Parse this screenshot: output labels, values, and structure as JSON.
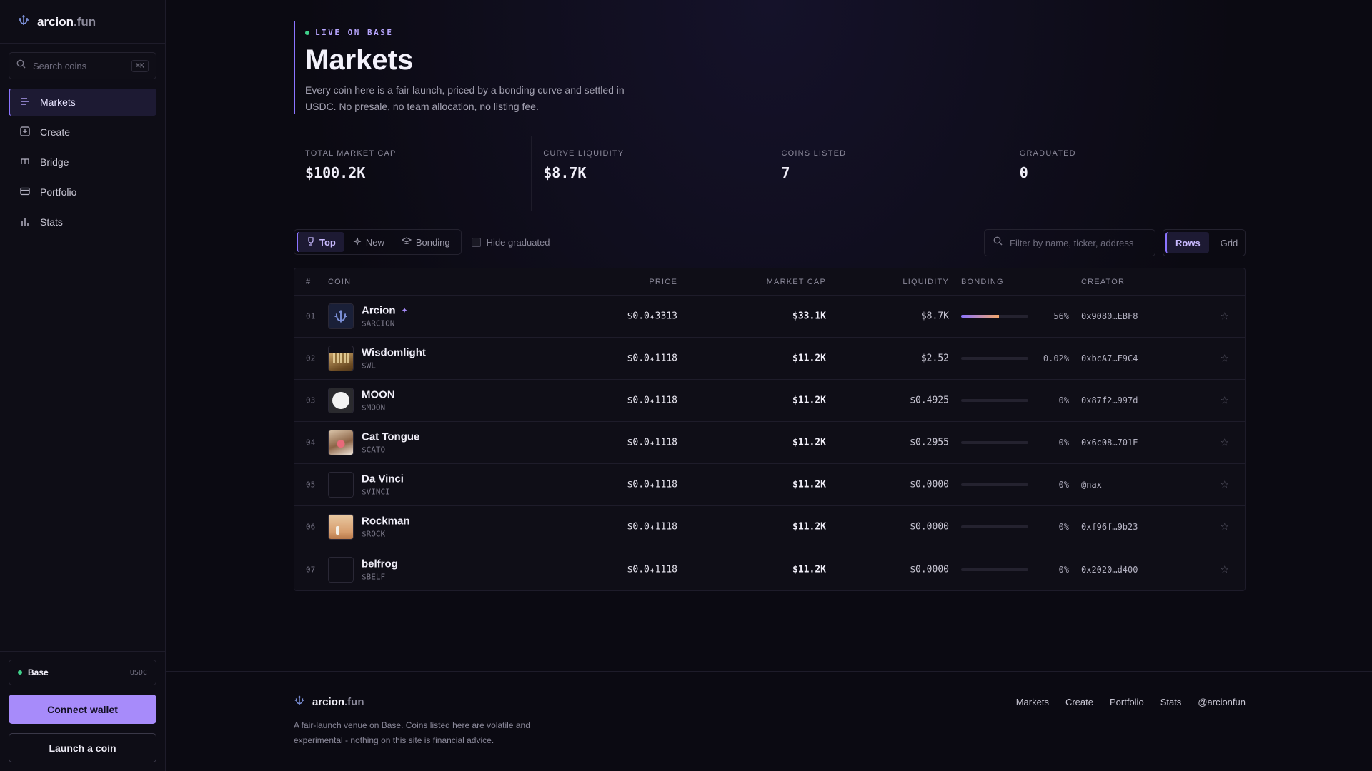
{
  "brand": {
    "name_main": "arcion",
    "name_suffix": ".fun"
  },
  "sidebar": {
    "search_placeholder": "Search coins",
    "search_shortcut": "⌘K",
    "nav": [
      {
        "label": "Markets",
        "icon": "list-icon",
        "active": true
      },
      {
        "label": "Create",
        "icon": "plus-square-icon",
        "active": false
      },
      {
        "label": "Bridge",
        "icon": "bridge-icon",
        "active": false
      },
      {
        "label": "Portfolio",
        "icon": "wallet-icon",
        "active": false
      },
      {
        "label": "Stats",
        "icon": "bar-chart-icon",
        "active": false
      }
    ],
    "network": {
      "name": "Base",
      "currency": "USDC",
      "status_color": "#3fd08a"
    },
    "connect_label": "Connect wallet",
    "launch_label": "Launch a coin"
  },
  "hero": {
    "live_label": "LIVE ON BASE",
    "title": "Markets",
    "subtitle": "Every coin here is a fair launch, priced by a bonding curve and settled in USDC. No presale, no team allocation, no listing fee."
  },
  "stats": [
    {
      "label": "TOTAL MARKET CAP",
      "value": "$100.2K"
    },
    {
      "label": "CURVE LIQUIDITY",
      "value": "$8.7K"
    },
    {
      "label": "COINS LISTED",
      "value": "7"
    },
    {
      "label": "GRADUATED",
      "value": "0"
    }
  ],
  "filters": {
    "tabs": [
      {
        "label": "Top",
        "icon": "trophy-icon",
        "active": true
      },
      {
        "label": "New",
        "icon": "sparkle-icon",
        "active": false
      },
      {
        "label": "Bonding",
        "icon": "graduation-cap-icon",
        "active": false
      }
    ],
    "hide_graduated_label": "Hide graduated",
    "filter_placeholder": "Filter by name, ticker, address",
    "view_rows": "Rows",
    "view_grid": "Grid"
  },
  "table": {
    "headers": {
      "rank": "#",
      "coin": "COIN",
      "price": "PRICE",
      "market_cap": "MARKET CAP",
      "liquidity": "LIQUIDITY",
      "bonding": "BONDING",
      "creator": "CREATOR"
    },
    "rows": [
      {
        "rank": "01",
        "name": "Arcion",
        "ticker": "$ARCION",
        "price": "$0.0₄3313",
        "market_cap": "$33.1K",
        "liquidity": "$8.7K",
        "bonding_pct": "56%",
        "bonding_value": 56,
        "creator": "0x9080…EBF8",
        "avatar": "arcion",
        "badge": "✦"
      },
      {
        "rank": "02",
        "name": "Wisdomlight",
        "ticker": "$WL",
        "price": "$0.0₄1118",
        "market_cap": "$11.2K",
        "liquidity": "$2.52",
        "bonding_pct": "0.02%",
        "bonding_value": 0.02,
        "creator": "0xbcA7…F9C4",
        "avatar": "wisdom"
      },
      {
        "rank": "03",
        "name": "MOON",
        "ticker": "$MOON",
        "price": "$0.0₄1118",
        "market_cap": "$11.2K",
        "liquidity": "$0.4925",
        "bonding_pct": "0%",
        "bonding_value": 0,
        "creator": "0x87f2…997d",
        "avatar": "moon"
      },
      {
        "rank": "04",
        "name": "Cat Tongue",
        "ticker": "$CATO",
        "price": "$0.0₄1118",
        "market_cap": "$11.2K",
        "liquidity": "$0.2955",
        "bonding_pct": "0%",
        "bonding_value": 0,
        "creator": "0x6c08…701E",
        "avatar": "cat"
      },
      {
        "rank": "05",
        "name": "Da Vinci",
        "ticker": "$VINCI",
        "price": "$0.0₄1118",
        "market_cap": "$11.2K",
        "liquidity": "$0.0000",
        "bonding_pct": "0%",
        "bonding_value": 0,
        "creator": "@nax",
        "avatar": "empty"
      },
      {
        "rank": "06",
        "name": "Rockman",
        "ticker": "$ROCK",
        "price": "$0.0₄1118",
        "market_cap": "$11.2K",
        "liquidity": "$0.0000",
        "bonding_pct": "0%",
        "bonding_value": 0,
        "creator": "0xf96f…9b23",
        "avatar": "rock"
      },
      {
        "rank": "07",
        "name": "belfrog",
        "ticker": "$BELF",
        "price": "$0.0₄1118",
        "market_cap": "$11.2K",
        "liquidity": "$0.0000",
        "bonding_pct": "0%",
        "bonding_value": 0,
        "creator": "0x2020…d400",
        "avatar": "empty"
      }
    ]
  },
  "footer": {
    "text": "A fair-launch venue on Base. Coins listed here are volatile and experimental - nothing on this site is financial advice.",
    "links": [
      "Markets",
      "Create",
      "Portfolio",
      "Stats",
      "@arcionfun"
    ]
  },
  "colors": {
    "accent": "#a78bfa",
    "accent_border": "#8b74ff",
    "background": "#0b0a12"
  }
}
